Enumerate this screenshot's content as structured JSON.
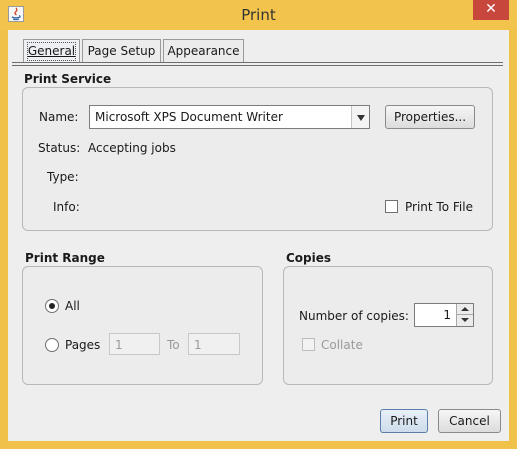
{
  "window": {
    "title": "Print"
  },
  "tabs": [
    {
      "label": "General",
      "active": true
    },
    {
      "label": "Page Setup",
      "active": false
    },
    {
      "label": "Appearance",
      "active": false
    }
  ],
  "print_service": {
    "heading": "Print Service",
    "name_label": "Name:",
    "printer": "Microsoft XPS Document Writer",
    "properties_label": "Properties...",
    "status_label": "Status:",
    "status_value": "Accepting jobs",
    "type_label": "Type:",
    "info_label": "Info:",
    "print_to_file_label": "Print To File",
    "print_to_file_checked": false
  },
  "print_range": {
    "heading": "Print Range",
    "all_label": "All",
    "pages_label": "Pages",
    "selected": "All",
    "from_value": "1",
    "to_label": "To",
    "to_value": "1"
  },
  "copies": {
    "heading": "Copies",
    "number_label": "Number of copies:",
    "number_value": "1",
    "collate_label": "Collate",
    "collate_checked": false
  },
  "buttons": {
    "print": "Print",
    "cancel": "Cancel"
  },
  "icons": {
    "app": "java-icon",
    "close": "close-icon"
  },
  "colors": {
    "titlebar": "#f2c44c",
    "close": "#c7473c",
    "dialog": "#eeeeee"
  }
}
